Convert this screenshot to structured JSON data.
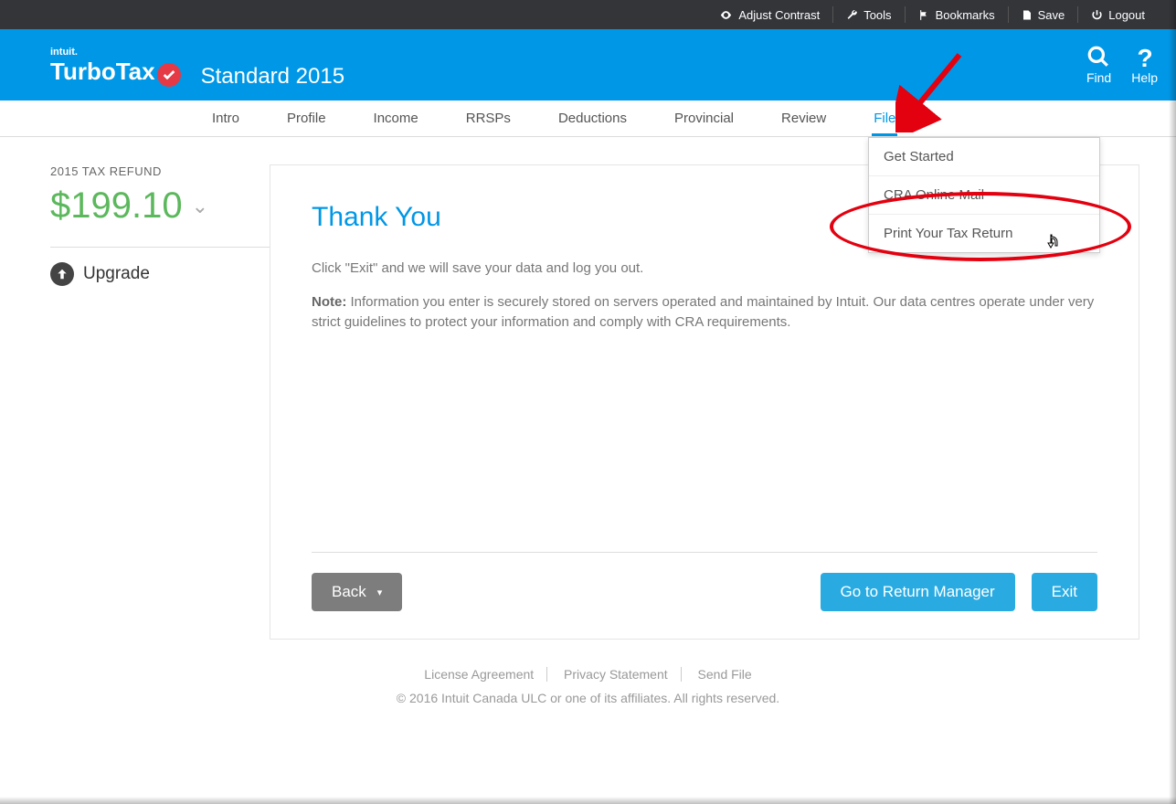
{
  "topbar": {
    "contrast": "Adjust Contrast",
    "tools": "Tools",
    "bookmarks": "Bookmarks",
    "save": "Save",
    "logout": "Logout"
  },
  "header": {
    "brand_small": "intuit.",
    "brand": "TurboTax",
    "product": "Standard 2015",
    "find": "Find",
    "help": "Help"
  },
  "nav": {
    "items": [
      "Intro",
      "Profile",
      "Income",
      "RRSPs",
      "Deductions",
      "Provincial",
      "Review",
      "File"
    ],
    "active": "File"
  },
  "sidebar": {
    "refund_label": "2015 TAX REFUND",
    "refund_amount": "$199.10",
    "upgrade": "Upgrade"
  },
  "dropdown": {
    "items": [
      "Get Started",
      "CRA Online Mail",
      "Print Your Tax Return"
    ]
  },
  "main": {
    "title": "Thank You",
    "line1": "Click \"Exit\" and we will save your data and log you out.",
    "note_label": "Note:",
    "note_body": "Information you enter is securely stored on servers operated and maintained by Intuit. Our data centres operate under very strict guidelines to protect your information and comply with CRA requirements.",
    "back": "Back",
    "return_manager": "Go to Return Manager",
    "exit": "Exit"
  },
  "footer": {
    "links": [
      "License Agreement",
      "Privacy Statement",
      "Send File"
    ],
    "copyright": "© 2016 Intuit Canada ULC or one of its affiliates. All rights reserved."
  }
}
